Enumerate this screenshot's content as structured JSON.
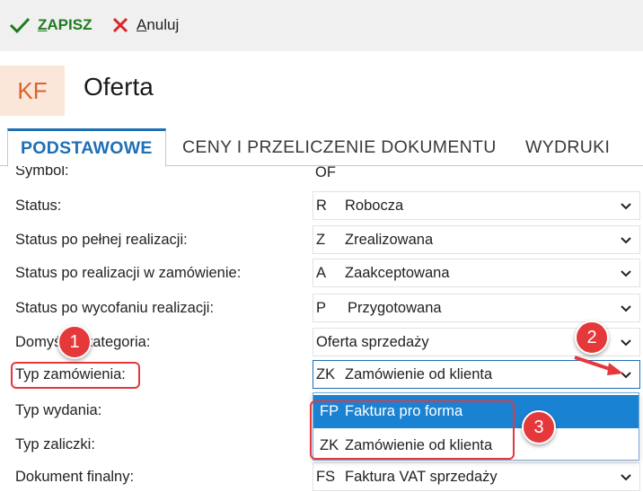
{
  "toolbar": {
    "save_first": "Z",
    "save_rest": "APISZ",
    "cancel_first": "A",
    "cancel_rest": "nuluj"
  },
  "header": {
    "badge": "KF",
    "title": "Oferta"
  },
  "tabs": [
    {
      "label": "PODSTAWOWE"
    },
    {
      "label": "CENY I PRZELICZENIE DOKUMENTU"
    },
    {
      "label": "WYDRUKI"
    }
  ],
  "form": {
    "symbol": {
      "label": "Symbol:",
      "value": "OF"
    },
    "status": {
      "label": "Status:",
      "code": "R",
      "value": "Robocza"
    },
    "status_full": {
      "label": "Status po pełnej realizacji:",
      "code": "Z",
      "value": "Zrealizowana"
    },
    "status_order": {
      "label": "Status po realizacji w zamówienie:",
      "code": "A",
      "value": "Zaakceptowana"
    },
    "status_withdraw": {
      "label": "Status po wycofaniu realizacji:",
      "code": "P",
      "value": "Przygotowana"
    },
    "default_category": {
      "label": "Domyślna kategoria:",
      "value": "Oferta sprzedaży"
    },
    "order_type": {
      "label": "Typ zamówienia:",
      "code": "ZK",
      "value": "Zamówienie od klienta"
    },
    "issue_type": {
      "label": "Typ wydania:"
    },
    "advance_type": {
      "label": "Typ zaliczki:"
    },
    "final_doc": {
      "label": "Dokument finalny:",
      "code": "FS",
      "value": "Faktura VAT sprzedaży"
    }
  },
  "dropdown": {
    "options": [
      {
        "code": "FP",
        "label": "Faktura pro forma",
        "selected": true
      },
      {
        "code": "ZK",
        "label": "Zamówienie od klienta",
        "selected": false
      }
    ]
  },
  "annotations": {
    "m1": "1",
    "m2": "2",
    "m3": "3"
  },
  "colors": {
    "accent": "#1f6fb5",
    "selected_bg": "#1a82d2",
    "marker": "#e5383b",
    "save_green": "#1f7a1f",
    "cancel_red": "#d8262a",
    "badge_bg": "#fbe6da",
    "badge_fg": "#d9652d"
  }
}
